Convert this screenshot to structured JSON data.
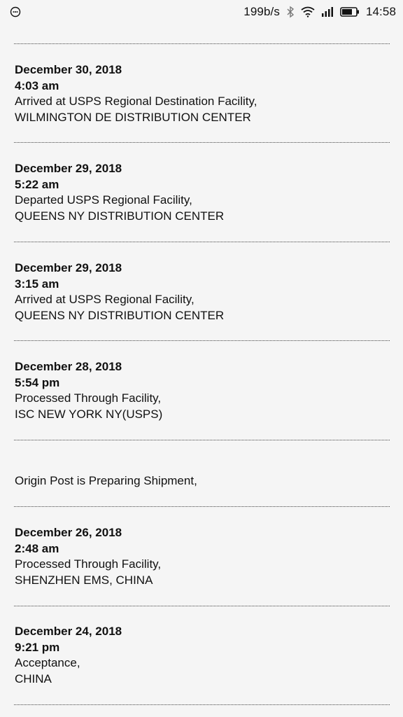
{
  "status_bar": {
    "network_speed": "199b/s",
    "time": "14:58",
    "icons": [
      "notification-icon",
      "bluetooth-icon",
      "wifi-icon",
      "signal-icon",
      "battery-icon"
    ]
  },
  "events": [
    {
      "date": "December 30, 2018",
      "time": "4:03 am",
      "status": "Arrived at USPS Regional Destination Facility,",
      "location": "WILMINGTON DE DISTRIBUTION CENTER"
    },
    {
      "date": "December 29, 2018",
      "time": "5:22 am",
      "status": "Departed USPS Regional Facility,",
      "location": "QUEENS NY DISTRIBUTION CENTER"
    },
    {
      "date": "December 29, 2018",
      "time": "3:15 am",
      "status": "Arrived at USPS Regional Facility,",
      "location": "QUEENS NY DISTRIBUTION CENTER"
    },
    {
      "date": "December 28, 2018",
      "time": "5:54 pm",
      "status": "Processed Through Facility,",
      "location": "ISC NEW YORK NY(USPS)"
    },
    {
      "date": "",
      "time": "",
      "status": "Origin Post is Preparing Shipment,",
      "location": ""
    },
    {
      "date": "December 26, 2018",
      "time": "2:48 am",
      "status": "Processed Through Facility,",
      "location": "SHENZHEN EMS, CHINA"
    },
    {
      "date": "December 24, 2018",
      "time": "9:21 pm",
      "status": "Acceptance,",
      "location": "CHINA"
    }
  ]
}
